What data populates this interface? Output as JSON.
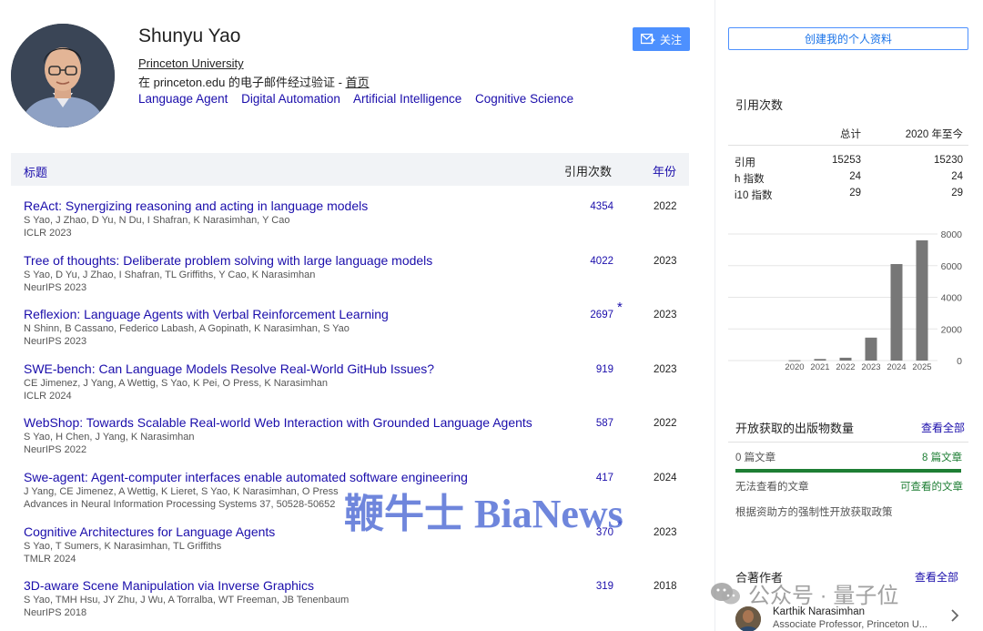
{
  "profile": {
    "name": "Shunyu Yao",
    "affiliation": "Princeton University",
    "email_prefix": "在 princeton.edu 的电子邮件经过验证 - ",
    "home_link": "首页",
    "interests": [
      "Language Agent",
      "Digital Automation",
      "Artificial Intelligence",
      "Cognitive Science"
    ],
    "follow_label": "关注",
    "create_profile_label": "创建我的个人资料"
  },
  "table": {
    "col_title": "标题",
    "col_cites": "引用次数",
    "col_year": "年份",
    "rows": [
      {
        "title": "ReAct: Synergizing reasoning and acting in language models",
        "authors": "S Yao, J Zhao, D Yu, N Du, I Shafran, K Narasimhan, Y Cao",
        "venue": "ICLR 2023",
        "cites": "4354",
        "star": "",
        "year": "2022"
      },
      {
        "title": "Tree of thoughts: Deliberate problem solving with large language models",
        "authors": "S Yao, D Yu, J Zhao, I Shafran, TL Griffiths, Y Cao, K Narasimhan",
        "venue": "NeurIPS 2023",
        "cites": "4022",
        "star": "",
        "year": "2023"
      },
      {
        "title": "Reflexion: Language Agents with Verbal Reinforcement Learning",
        "authors": "N Shinn, B Cassano, Federico Labash, A Gopinath, K Narasimhan, S Yao",
        "venue": "NeurIPS 2023",
        "cites": "2697",
        "star": "*",
        "year": "2023"
      },
      {
        "title": "SWE-bench: Can Language Models Resolve Real-World GitHub Issues?",
        "authors": "CE Jimenez, J Yang, A Wettig, S Yao, K Pei, O Press, K Narasimhan",
        "venue": "ICLR 2024",
        "cites": "919",
        "star": "",
        "year": "2023"
      },
      {
        "title": "WebShop: Towards Scalable Real-world Web Interaction with Grounded Language Agents",
        "authors": "S Yao, H Chen, J Yang, K Narasimhan",
        "venue": "NeurIPS 2022",
        "cites": "587",
        "star": "",
        "year": "2022"
      },
      {
        "title": "Swe-agent: Agent-computer interfaces enable automated software engineering",
        "authors": "J Yang, CE Jimenez, A Wettig, K Lieret, S Yao, K Narasimhan, O Press",
        "venue": "Advances in Neural Information Processing Systems 37, 50528-50652",
        "cites": "417",
        "star": "",
        "year": "2024"
      },
      {
        "title": "Cognitive Architectures for Language Agents",
        "authors": "S Yao, T Sumers, K Narasimhan, TL Griffiths",
        "venue": "TMLR 2024",
        "cites": "370",
        "star": "*",
        "year": "2023"
      },
      {
        "title": "3D-aware Scene Manipulation via Inverse Graphics",
        "authors": "S Yao, TMH Hsu, JY Zhu, J Wu, A Torralba, WT Freeman, JB Tenenbaum",
        "venue": "NeurIPS 2018",
        "cites": "319",
        "star": "",
        "year": "2018"
      }
    ]
  },
  "citations": {
    "title": "引用次数",
    "col_total": "总计",
    "col_since": "2020 年至今",
    "rows": [
      {
        "label": "引用",
        "total": "15253",
        "since": "15230"
      },
      {
        "label": "h 指数",
        "total": "24",
        "since": "24"
      },
      {
        "label": "i10 指数",
        "total": "29",
        "since": "29"
      }
    ]
  },
  "chart_data": {
    "type": "bar",
    "categories": [
      "2020",
      "2021",
      "2022",
      "2023",
      "2024",
      "2025"
    ],
    "values": [
      20,
      100,
      180,
      1450,
      6100,
      7600
    ],
    "ylim": [
      0,
      8000
    ],
    "yticks": [
      "0",
      "2000",
      "4000",
      "6000",
      "8000"
    ],
    "bar_color": "#777777",
    "grid": true
  },
  "open_access": {
    "title": "开放获取的出版物数量",
    "view_all": "查看全部",
    "not_available": "0 篇文章",
    "available": "8 篇文章",
    "not_viewable_label": "无法查看的文章",
    "viewable_label": "可查看的文章",
    "available_fraction": 1.0,
    "policy_note": "根据资助方的强制性开放获取政策"
  },
  "coauthors": {
    "title": "合著作者",
    "view_all": "查看全部",
    "items": [
      {
        "name": "Karthik Narasimhan",
        "role": "Associate Professor, Princeton U..."
      }
    ]
  },
  "watermarks": {
    "main": "鞭牛士 BiaNews",
    "sub": "公众号 · 量子位"
  }
}
